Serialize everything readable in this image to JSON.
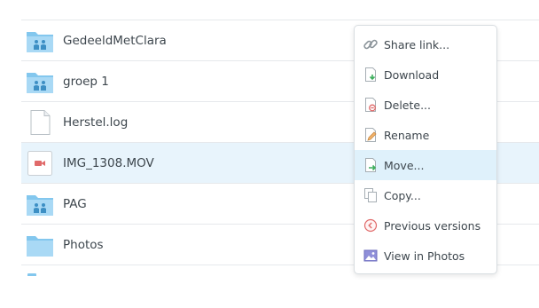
{
  "files": [
    {
      "name": "GedeeldMetClara",
      "icon": "shared-folder-icon",
      "selected": false
    },
    {
      "name": "groep 1",
      "icon": "shared-folder-icon",
      "selected": false
    },
    {
      "name": "Herstel.log",
      "icon": "document-icon",
      "selected": false
    },
    {
      "name": "IMG_1308.MOV",
      "icon": "video-file-icon",
      "selected": true
    },
    {
      "name": "PAG",
      "icon": "shared-folder-icon",
      "selected": false
    },
    {
      "name": "Photos",
      "icon": "folder-icon",
      "selected": false
    }
  ],
  "context_menu": {
    "items": [
      {
        "label": "Share link...",
        "icon": "link-icon"
      },
      {
        "label": "Download",
        "icon": "download-icon"
      },
      {
        "label": "Delete...",
        "icon": "delete-icon"
      },
      {
        "label": "Rename",
        "icon": "rename-icon"
      },
      {
        "label": "Move...",
        "icon": "move-icon",
        "highlighted": true
      },
      {
        "label": "Copy...",
        "icon": "copy-icon"
      },
      {
        "label": "Previous versions",
        "icon": "history-icon"
      },
      {
        "label": "View in Photos",
        "icon": "photos-icon"
      }
    ]
  },
  "colors": {
    "folder": "#83c7ee",
    "selected_row": "#e8f4fc",
    "menu_hover": "#dff1fb",
    "video_red": "#e06a6a",
    "move_green": "#3cae5b"
  }
}
